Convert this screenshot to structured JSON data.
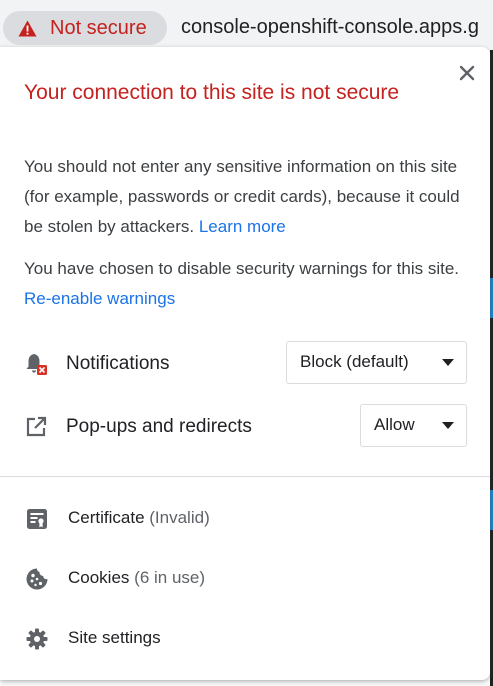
{
  "omnibox": {
    "security_label": "Not secure",
    "url": "console-openshift-console.apps.g"
  },
  "popup": {
    "title": "Your connection to this site is not secure",
    "warning_text": "You should not enter any sensitive information on this site (for example, passwords or credit cards), because it could be stolen by attackers.",
    "learn_more": "Learn more",
    "disabled_text": "You have chosen to disable security warnings for this site.",
    "reenable_link": "Re-enable warnings",
    "permissions": [
      {
        "label": "Notifications",
        "icon": "notifications-blocked-icon",
        "value": "Block (default)"
      },
      {
        "label": "Pop-ups and redirects",
        "icon": "open-in-new-icon",
        "value": "Allow"
      }
    ],
    "links": [
      {
        "label": "Certificate",
        "sub": "(Invalid)",
        "icon": "certificate-icon"
      },
      {
        "label": "Cookies",
        "sub": "(6 in use)",
        "icon": "cookie-icon"
      },
      {
        "label": "Site settings",
        "sub": "",
        "icon": "gear-icon"
      }
    ]
  },
  "colors": {
    "danger": "#c5221f",
    "link": "#1a73e8",
    "icon": "#5f6368"
  }
}
